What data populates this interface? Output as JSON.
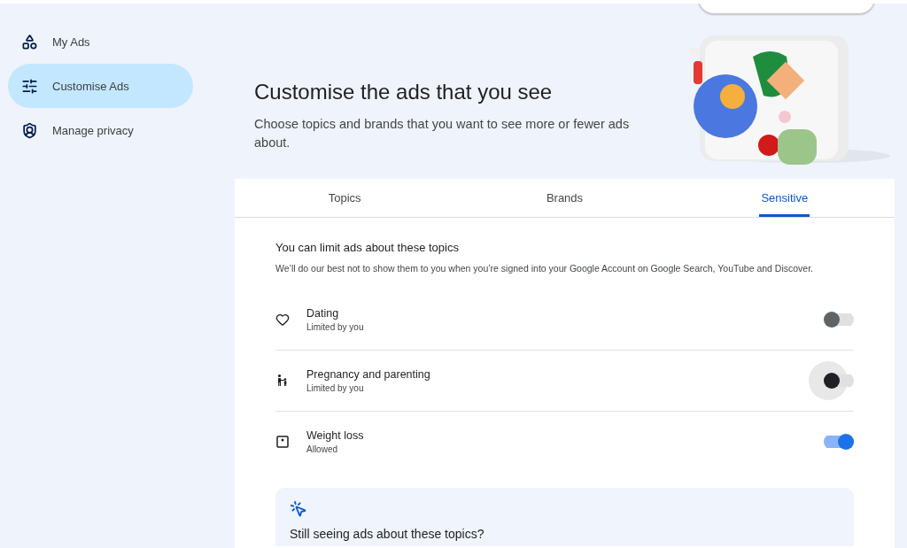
{
  "sidebar": {
    "items": [
      {
        "label": "My Ads",
        "selected": false
      },
      {
        "label": "Customise Ads",
        "selected": true
      },
      {
        "label": "Manage privacy",
        "selected": false
      }
    ]
  },
  "header": {
    "title": "Customise the ads that you see",
    "subtitle": "Choose topics and brands that you want to see more or fewer ads about."
  },
  "tabs": [
    {
      "label": "Topics",
      "selected": false
    },
    {
      "label": "Brands",
      "selected": false
    },
    {
      "label": "Sensitive",
      "selected": true
    }
  ],
  "section": {
    "title": "You can limit ads about these topics",
    "description": "We’ll do our best not to show them to you when you’re signed into your Google Account on Google Search, YouTube and Discover."
  },
  "topics": [
    {
      "name": "Dating",
      "status": "Limited by you",
      "on": false,
      "focused": false
    },
    {
      "name": "Pregnancy and parenting",
      "status": "Limited by you",
      "on": false,
      "focused": true
    },
    {
      "name": "Weight loss",
      "status": "Allowed",
      "on": true,
      "focused": false
    }
  ],
  "help_card": {
    "title": "Still seeing ads about these topics?"
  }
}
